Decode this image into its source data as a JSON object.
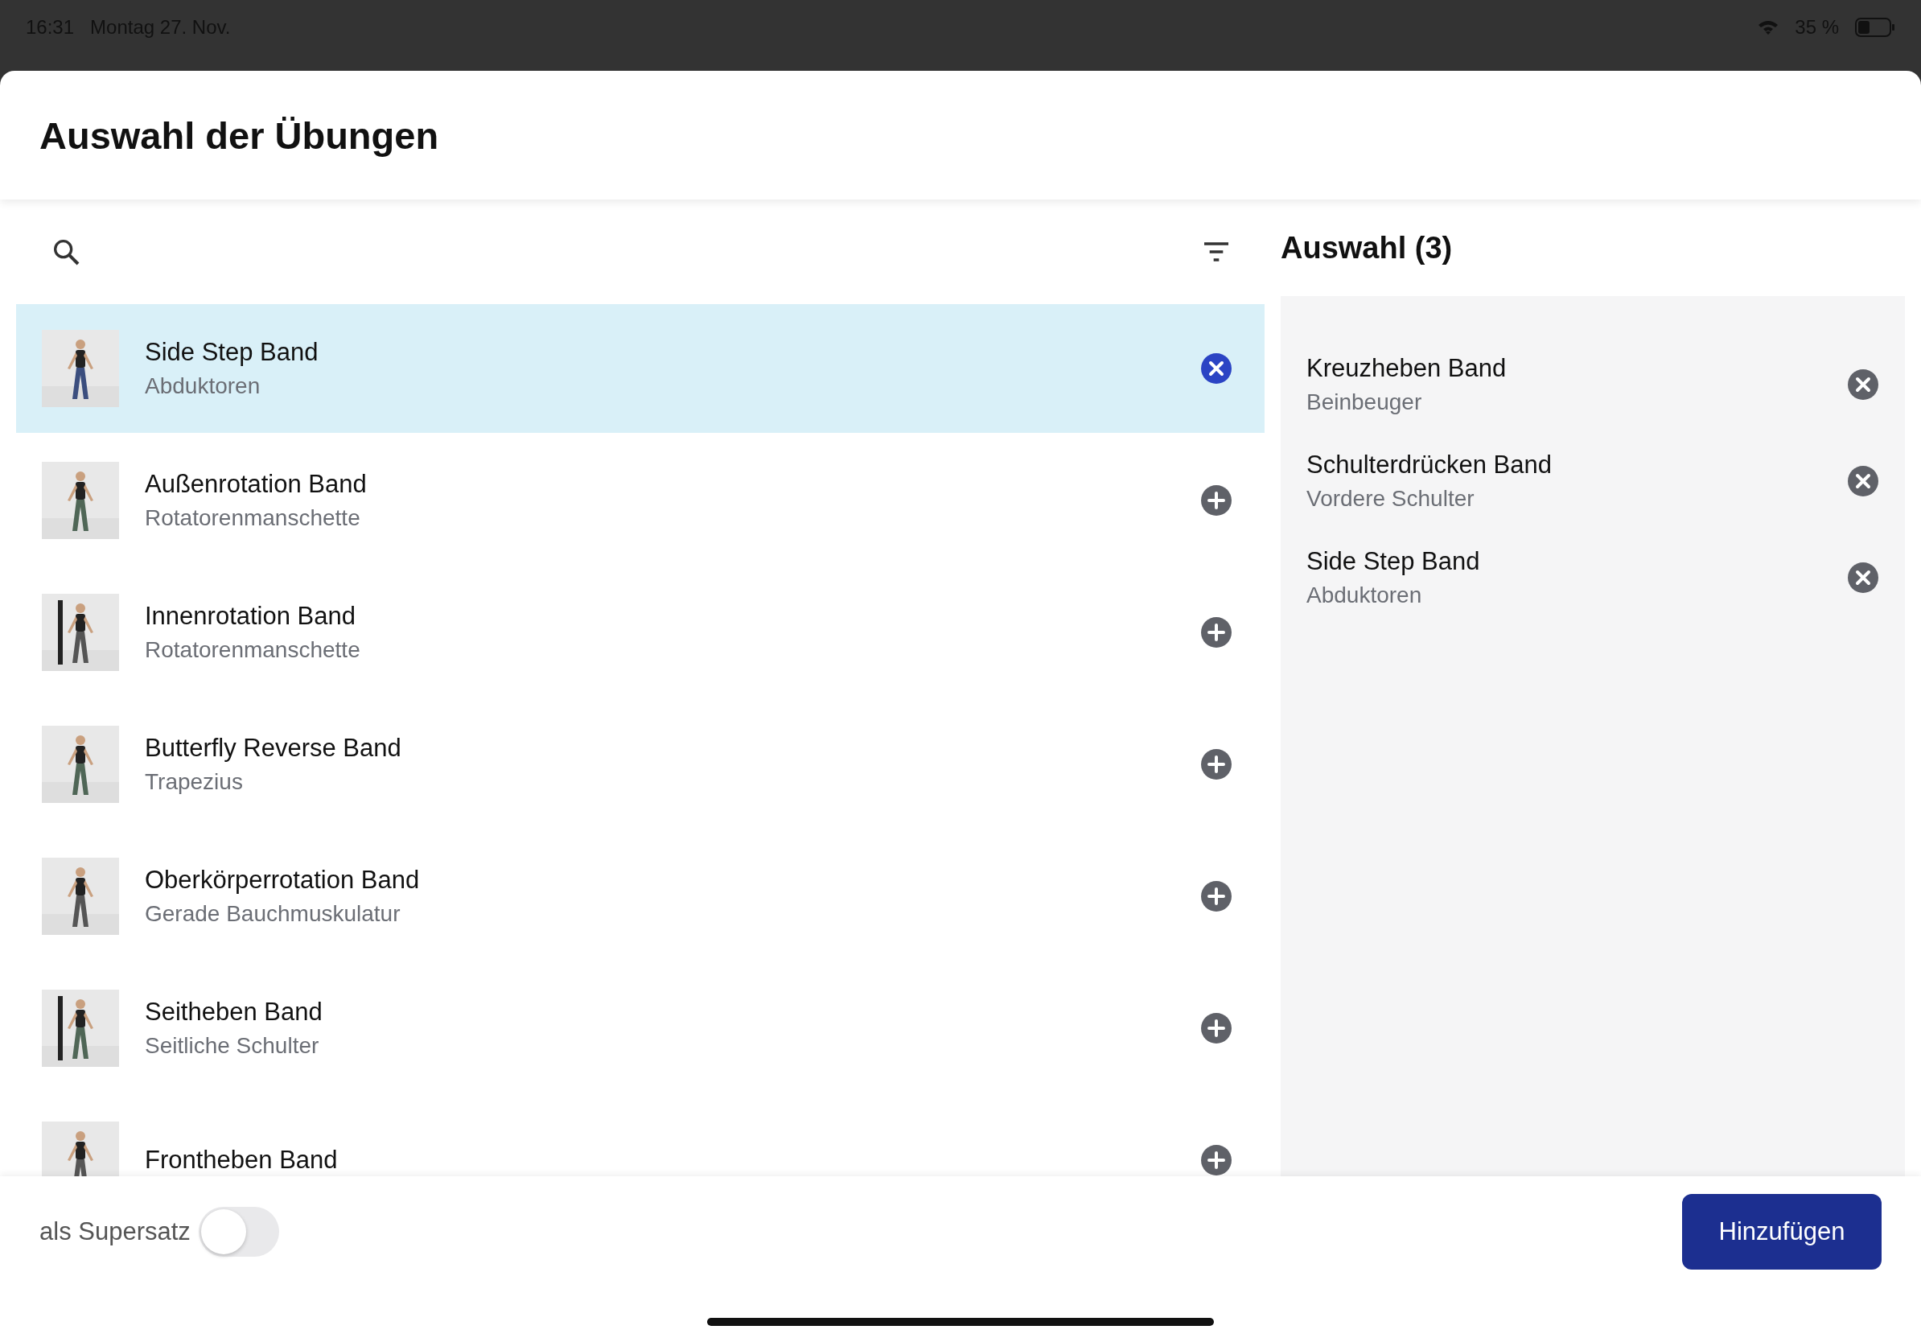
{
  "status_bar": {
    "time": "16:31",
    "date": "Montag 27. Nov.",
    "battery": "35 %"
  },
  "sheet": {
    "title": "Auswahl der Übungen"
  },
  "exercises": [
    {
      "name": "Side Step Band",
      "muscle": "Abduktoren",
      "selected": true
    },
    {
      "name": "Außenrotation Band",
      "muscle": "Rotatorenmanschette",
      "selected": false
    },
    {
      "name": "Innenrotation Band",
      "muscle": "Rotatorenmanschette",
      "selected": false
    },
    {
      "name": "Butterfly Reverse Band",
      "muscle": "Trapezius",
      "selected": false
    },
    {
      "name": "Oberkörperrotation Band",
      "muscle": "Gerade Bauchmuskulatur",
      "selected": false
    },
    {
      "name": "Seitheben Band",
      "muscle": "Seitliche Schulter",
      "selected": false
    },
    {
      "name": "Frontheben Band",
      "selected": false
    }
  ],
  "selection": {
    "title": "Auswahl (3)",
    "items": [
      {
        "name": "Kreuzheben Band",
        "muscle": "Beinbeuger"
      },
      {
        "name": "Schulterdrücken Band",
        "muscle": "Vordere Schulter"
      },
      {
        "name": "Side Step Band",
        "muscle": "Abduktoren"
      }
    ]
  },
  "footer": {
    "superset_label": "als Supersatz",
    "superset_on": false,
    "add_button": "Hinzufügen"
  }
}
